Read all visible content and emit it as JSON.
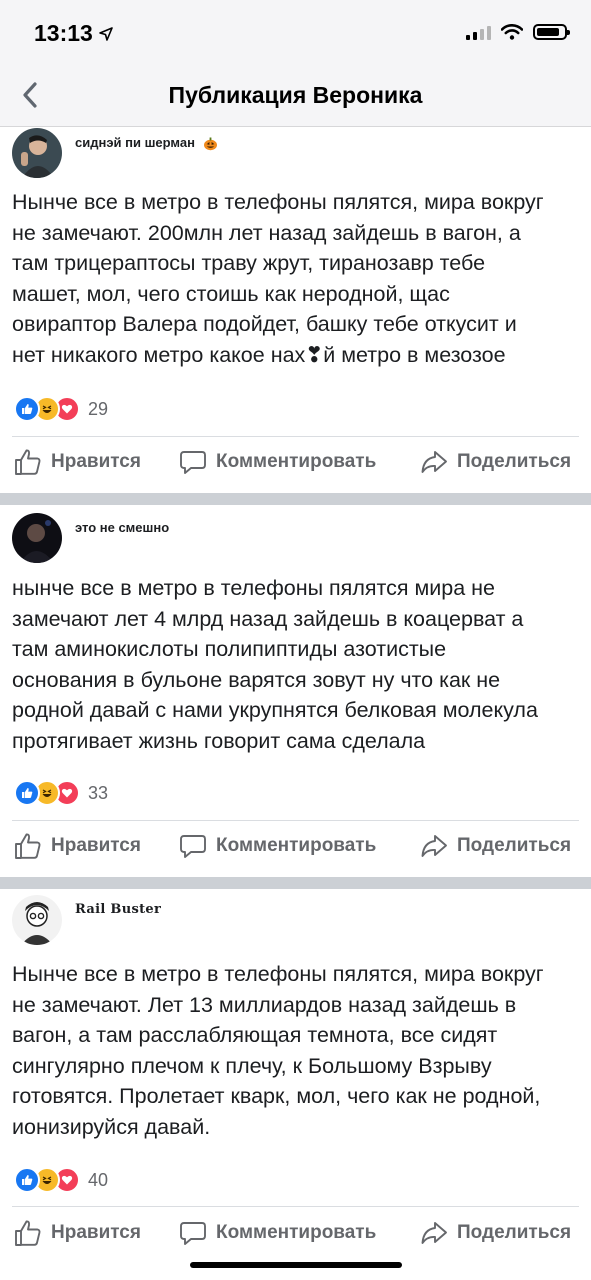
{
  "status_bar": {
    "time": "13:13"
  },
  "nav": {
    "title": "Публикация Вероника"
  },
  "posts": [
    {
      "author": "сиднэй пи шерман",
      "text": "Нынче все в метро в телефоны пялятся, мира вокруг\nне замечают. 200млн лет назад зайдешь в вагон, а\nтам трицераптосы траву жрут, тиранозавр тебе\nмашет, мол, чего стоишь как неродной, щас\nовираптор Валера подойдет, башку тебе откусит и\nнет никакого метро какое нах❣й метро в мезозое",
      "reaction_count": "29"
    },
    {
      "author": "это не смешно",
      "text": "нынче все в метро в телефоны пялятся мира не\nзамечают лет 4 млрд назад зайдешь в коацерват а\nтам аминокислоты полипиптиды азотистые\nоснования в бульоне варятся зовут ну что как не\nродной давай с нами укрупнятся белковая молекула\nпротягивает жизнь говорит сама сделала",
      "reaction_count": "33"
    },
    {
      "author": "Rail Buster",
      "text": "Нынче все в метро в телефоны пялятся, мира вокруг\nне замечают. Лет 13 миллиардов назад зайдешь в\nвагон, а там расслабляющая темнота, все сидят\nсингулярно плечом к плечу, к Большому Взрыву\nготовятся. Пролетает кварк, мол, чего как не родной,\nионизируйся давай.",
      "reaction_count": "40"
    }
  ],
  "actions": {
    "like": "Нравится",
    "comment": "Комментировать",
    "share": "Поделиться"
  },
  "colors": {
    "accent": "#1877f2",
    "separator": "#ccd0d5",
    "secondary_text": "#65676b"
  }
}
